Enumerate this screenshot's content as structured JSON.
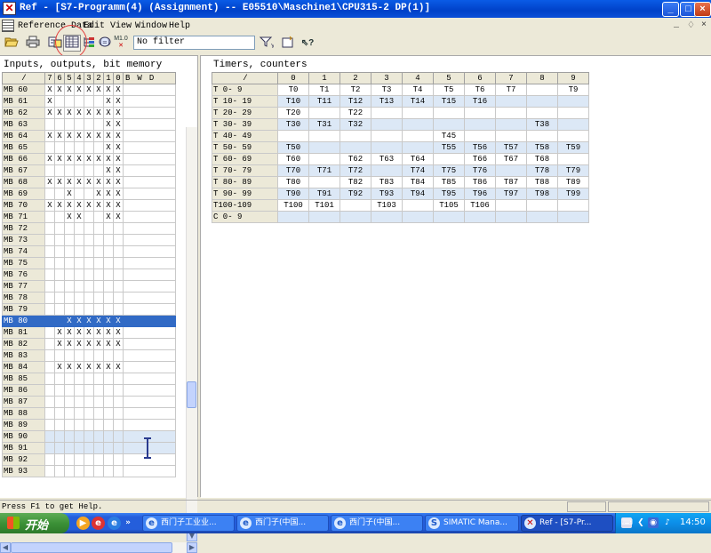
{
  "window": {
    "title": "Ref - [S7-Programm(4) (Assignment) -- E05510\\Maschine1\\CPU315-2 DP(1)]",
    "icon": "ref-cross-icon",
    "minimize": "_",
    "maximize": "□",
    "close": "×"
  },
  "menubar": {
    "items": [
      "Reference Data",
      "Edit",
      "View",
      "Window",
      "Help"
    ],
    "mdi_controls": [
      "_",
      "♢",
      "×"
    ]
  },
  "toolbar": {
    "buttons": [
      "open-icon",
      "print-icon",
      "cross-reference-icon",
      "assignment-icon",
      "program-structure-icon",
      "unused-symbols-icon",
      "addresses-without-symbols-icon"
    ],
    "m10_label": "M1.0",
    "filter_value": "No filter",
    "buttons_right": [
      "filter-icon",
      "new-window-icon",
      "help-icon"
    ]
  },
  "left_pane": {
    "title": "Inputs, outputs, bit memory",
    "columns": [
      "/",
      "7",
      "6",
      "5",
      "4",
      "3",
      "2",
      "1",
      "0",
      "B",
      "W",
      "D"
    ],
    "rows": [
      {
        "label": "MB 60",
        "bits": "XXXXXXXX"
      },
      {
        "label": "MB 61",
        "bits": "X     XX"
      },
      {
        "label": "MB 62",
        "bits": "XXXXXXXX"
      },
      {
        "label": "MB 63",
        "bits": "      XX"
      },
      {
        "label": "MB 64",
        "bits": "XXXXXXXX"
      },
      {
        "label": "MB 65",
        "bits": "      XX"
      },
      {
        "label": "MB 66",
        "bits": "XXXXXXXX"
      },
      {
        "label": "MB 67",
        "bits": "      XX"
      },
      {
        "label": "MB 68",
        "bits": "XXXXXXXX"
      },
      {
        "label": "MB 69",
        "bits": "  X  XXX"
      },
      {
        "label": "MB 70",
        "bits": "XXXXXXXX"
      },
      {
        "label": "MB 71",
        "bits": "  XX  XX"
      },
      {
        "label": "MB 72",
        "bits": "        "
      },
      {
        "label": "MB 73",
        "bits": "        "
      },
      {
        "label": "MB 74",
        "bits": "        "
      },
      {
        "label": "MB 75",
        "bits": "        "
      },
      {
        "label": "MB 76",
        "bits": "        "
      },
      {
        "label": "MB 77",
        "bits": "        "
      },
      {
        "label": "MB 78",
        "bits": "        "
      },
      {
        "label": "MB 79",
        "bits": "        "
      },
      {
        "label": "MB 80",
        "bits": "  XXXXXX",
        "selected": true
      },
      {
        "label": "MB 81",
        "bits": " XXXXXXX"
      },
      {
        "label": "MB 82",
        "bits": " XXXXXXX"
      },
      {
        "label": "MB 83",
        "bits": "        "
      },
      {
        "label": "MB 84",
        "bits": " XXXXXXX"
      },
      {
        "label": "MB 85",
        "bits": "        "
      },
      {
        "label": "MB 86",
        "bits": "        "
      },
      {
        "label": "MB 87",
        "bits": "        "
      },
      {
        "label": "MB 88",
        "bits": "        "
      },
      {
        "label": "MB 89",
        "bits": "        "
      },
      {
        "label": "MB 90",
        "bits": "        ",
        "highlight": true
      },
      {
        "label": "MB 91",
        "bits": "        ",
        "highlight": true
      },
      {
        "label": "MB 92",
        "bits": "        "
      },
      {
        "label": "MB 93",
        "bits": "        "
      }
    ]
  },
  "right_pane": {
    "title": "Timers, counters",
    "columns": [
      "/",
      "0",
      "1",
      "2",
      "3",
      "4",
      "5",
      "6",
      "7",
      "8",
      "9"
    ],
    "rows": [
      {
        "label": "T  0-  9",
        "cells": [
          "T0",
          "T1",
          "T2",
          "T3",
          "T4",
          "T5",
          "T6",
          "T7",
          "",
          "T9"
        ]
      },
      {
        "label": "T 10- 19",
        "cells": [
          "T10",
          "T11",
          "T12",
          "T13",
          "T14",
          "T15",
          "T16",
          "",
          "",
          ""
        ]
      },
      {
        "label": "T 20- 29",
        "cells": [
          "T20",
          "",
          "T22",
          "",
          "",
          "",
          "",
          "",
          "",
          ""
        ]
      },
      {
        "label": "T 30- 39",
        "cells": [
          "T30",
          "T31",
          "T32",
          "",
          "",
          "",
          "",
          "",
          "T38",
          ""
        ]
      },
      {
        "label": "T 40- 49",
        "cells": [
          "",
          "",
          "",
          "",
          "",
          "T45",
          "",
          "",
          "",
          ""
        ]
      },
      {
        "label": "T 50- 59",
        "cells": [
          "T50",
          "",
          "",
          "",
          "",
          "T55",
          "T56",
          "T57",
          "T58",
          "T59"
        ]
      },
      {
        "label": "T 60- 69",
        "cells": [
          "T60",
          "",
          "T62",
          "T63",
          "T64",
          "",
          "T66",
          "T67",
          "T68",
          ""
        ]
      },
      {
        "label": "T 70- 79",
        "cells": [
          "T70",
          "T71",
          "T72",
          "",
          "T74",
          "T75",
          "T76",
          "",
          "T78",
          "T79"
        ]
      },
      {
        "label": "T 80- 89",
        "cells": [
          "T80",
          "",
          "T82",
          "T83",
          "T84",
          "T85",
          "T86",
          "T87",
          "T88",
          "T89"
        ]
      },
      {
        "label": "T 90- 99",
        "cells": [
          "T90",
          "T91",
          "T92",
          "T93",
          "T94",
          "T95",
          "T96",
          "T97",
          "T98",
          "T99"
        ]
      },
      {
        "label": "T100-109",
        "cells": [
          "T100",
          "T101",
          "",
          "T103",
          "",
          "T105",
          "T106",
          "",
          "",
          ""
        ]
      },
      {
        "label": "C  0-  9",
        "cells": [
          "",
          "",
          "",
          "",
          "",
          "",
          "",
          "",
          "",
          ""
        ]
      }
    ]
  },
  "statusbar": {
    "text": "Press F1 to get Help."
  },
  "taskbar": {
    "start_label": "开始",
    "quicklaunch": [
      "media-player-icon",
      "ie-icon",
      "browser-icon"
    ],
    "chevron": "»",
    "tasks": [
      {
        "label": "西门子工业业...",
        "icon": "ie-icon",
        "active": false
      },
      {
        "label": "西门子(中国...",
        "icon": "ie-icon",
        "active": false
      },
      {
        "label": "西门子(中国...",
        "icon": "ie-icon",
        "active": false
      },
      {
        "label": "SIMATIC Mana...",
        "icon": "simatic-icon",
        "active": false
      },
      {
        "label": "Ref - [S7-Pr...",
        "icon": "ref-icon",
        "active": true
      }
    ],
    "clock": "14:50"
  }
}
